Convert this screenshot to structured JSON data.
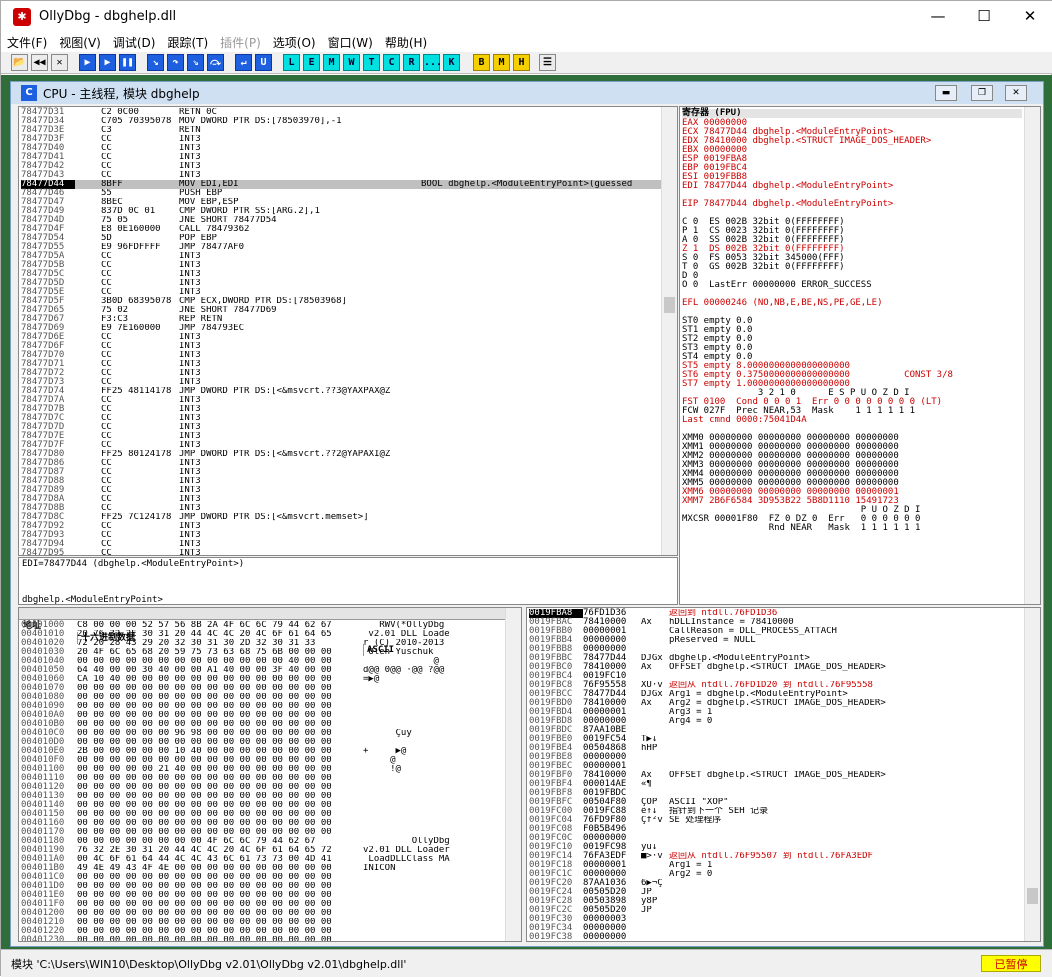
{
  "window": {
    "title": "OllyDbg - dbghelp.dll",
    "logo": "bug-icon"
  },
  "menu": [
    "文件(F)",
    "视图(V)",
    "调试(D)",
    "跟踪(T)",
    "插件(P)",
    "选项(O)",
    "窗口(W)",
    "帮助(H)"
  ],
  "toolbar_letters": [
    "L",
    "E",
    "M",
    "W",
    "T",
    "C",
    "R",
    "...",
    "K",
    "B",
    "M",
    "H"
  ],
  "cpu": {
    "title": "CPU - 主线程, 模块 dbghelp"
  },
  "disasm": [
    [
      "78477D31",
      "C2 0C00",
      "RETN 0C",
      ""
    ],
    [
      "78477D34",
      "C705 70395078",
      "MOV DWORD PTR DS:[78503970],-1",
      ""
    ],
    [
      "78477D3E",
      "C3",
      "RETN",
      ""
    ],
    [
      "78477D3F",
      "CC",
      "INT3",
      ""
    ],
    [
      "78477D40",
      "CC",
      "INT3",
      ""
    ],
    [
      "78477D41",
      "CC",
      "INT3",
      ""
    ],
    [
      "78477D42",
      "CC",
      "INT3",
      ""
    ],
    [
      "78477D43",
      "CC",
      "INT3",
      ""
    ],
    [
      "78477D44",
      "8BFF",
      "MOV EDI,EDI",
      "BOOL dbghelp.<ModuleEntryPoint>(guessed"
    ],
    [
      "78477D46",
      "55",
      "PUSH EBP",
      ""
    ],
    [
      "78477D47",
      "8BEC",
      "MOV EBP,ESP",
      ""
    ],
    [
      "78477D49",
      "837D 0C 01",
      "CMP DWORD PTR SS:[ARG.2],1",
      ""
    ],
    [
      "78477D4D",
      "75 05",
      "JNE SHORT 78477D54",
      ""
    ],
    [
      "78477D4F",
      "E8 0E160000",
      "CALL 78479362",
      ""
    ],
    [
      "78477D54",
      "5D",
      "POP EBP",
      ""
    ],
    [
      "78477D55",
      "E9 96FDFFFF",
      "JMP 78477AF0",
      ""
    ],
    [
      "78477D5A",
      "CC",
      "INT3",
      ""
    ],
    [
      "78477D5B",
      "CC",
      "INT3",
      ""
    ],
    [
      "78477D5C",
      "CC",
      "INT3",
      ""
    ],
    [
      "78477D5D",
      "CC",
      "INT3",
      ""
    ],
    [
      "78477D5E",
      "CC",
      "INT3",
      ""
    ],
    [
      "78477D5F",
      "3B0D 68395078",
      "CMP ECX,DWORD PTR DS:[78503968]",
      ""
    ],
    [
      "78477D65",
      "75 02",
      "JNE SHORT 78477D69",
      ""
    ],
    [
      "78477D67",
      "F3:C3",
      "REP RETN",
      ""
    ],
    [
      "78477D69",
      "E9 7E160000",
      "JMP 784793EC",
      ""
    ],
    [
      "78477D6E",
      "CC",
      "INT3",
      ""
    ],
    [
      "78477D6F",
      "CC",
      "INT3",
      ""
    ],
    [
      "78477D70",
      "CC",
      "INT3",
      ""
    ],
    [
      "78477D71",
      "CC",
      "INT3",
      ""
    ],
    [
      "78477D72",
      "CC",
      "INT3",
      ""
    ],
    [
      "78477D73",
      "CC",
      "INT3",
      ""
    ],
    [
      "78477D74",
      "FF25 48114178",
      "JMP DWORD PTR DS:[<&msvcrt.??3@YAXPAX@Z",
      ""
    ],
    [
      "78477D7A",
      "CC",
      "INT3",
      ""
    ],
    [
      "78477D7B",
      "CC",
      "INT3",
      ""
    ],
    [
      "78477D7C",
      "CC",
      "INT3",
      ""
    ],
    [
      "78477D7D",
      "CC",
      "INT3",
      ""
    ],
    [
      "78477D7E",
      "CC",
      "INT3",
      ""
    ],
    [
      "78477D7F",
      "CC",
      "INT3",
      ""
    ],
    [
      "78477D80",
      "FF25 80124178",
      "JMP DWORD PTR DS:[<&msvcrt.??2@YAPAXI@Z",
      ""
    ],
    [
      "78477D86",
      "CC",
      "INT3",
      ""
    ],
    [
      "78477D87",
      "CC",
      "INT3",
      ""
    ],
    [
      "78477D88",
      "CC",
      "INT3",
      ""
    ],
    [
      "78477D89",
      "CC",
      "INT3",
      ""
    ],
    [
      "78477D8A",
      "CC",
      "INT3",
      ""
    ],
    [
      "78477D8B",
      "CC",
      "INT3",
      ""
    ],
    [
      "78477D8C",
      "FF25 7C124178",
      "JMP DWORD PTR DS:[<&msvcrt.memset>]",
      ""
    ],
    [
      "78477D92",
      "CC",
      "INT3",
      ""
    ],
    [
      "78477D93",
      "CC",
      "INT3",
      ""
    ],
    [
      "78477D94",
      "CC",
      "INT3",
      ""
    ],
    [
      "78477D95",
      "CC",
      "INT3",
      ""
    ]
  ],
  "info": {
    "line1": "EDI=78477D44 (dbghelp.<ModuleEntryPoint>)",
    "line2": "dbghelp.<ModuleEntryPoint>"
  },
  "registers": {
    "header": "寄存器 (FPU)",
    "lines": [
      "EAX 00000000",
      "ECX 78477D44 dbghelp.<ModuleEntryPoint>",
      "EDX 78410000 dbghelp.<STRUCT IMAGE_DOS_HEADER>",
      "EBX 00000000",
      "ESP 0019FBA8",
      "EBP 0019FBC4",
      "ESI 0019FBB8",
      "EDI 78477D44 dbghelp.<ModuleEntryPoint>",
      "",
      "EIP 78477D44 dbghelp.<ModuleEntryPoint>",
      "",
      "C 0  ES 002B 32bit 0(FFFFFFFF)",
      "P 1  CS 0023 32bit 0(FFFFFFFF)",
      "A 0  SS 002B 32bit 0(FFFFFFFF)",
      "Z 1  DS 002B 32bit 0(FFFFFFFF)",
      "S 0  FS 0053 32bit 345000(FFF)",
      "T 0  GS 002B 32bit 0(FFFFFFFF)",
      "D 0",
      "O 0  LastErr 00000000 ERROR_SUCCESS",
      "",
      "EFL 00000246 (NO,NB,E,BE,NS,PE,GE,LE)",
      "",
      "ST0 empty 0.0",
      "ST1 empty 0.0",
      "ST2 empty 0.0",
      "ST3 empty 0.0",
      "ST4 empty 0.0",
      "ST5 empty 8.0000000000000000000",
      "ST6 empty 0.3750000000000000000          CONST 3/8",
      "ST7 empty 1.0000000000000000000",
      "              3 2 1 0      E S P U O Z D I",
      "FST 0100  Cond 0 0 0 1  Err 0 0 0 0 0 0 0 0 (LT)",
      "FCW 027F  Prec NEAR,53  Mask    1 1 1 1 1 1",
      "Last cmnd 0000:75041D4A",
      "",
      "XMM0 00000000 00000000 00000000 00000000",
      "XMM1 00000000 00000000 00000000 00000000",
      "XMM2 00000000 00000000 00000000 00000000",
      "XMM3 00000000 00000000 00000000 00000000",
      "XMM4 00000000 00000000 00000000 00000000",
      "XMM5 00000000 00000000 00000000 00000000",
      "XMM6 00000000 00000000 00000000 00000001",
      "XMM7 2B6F6584 3D953B22 5B8D1110 15491723",
      "                                 P U O Z D I",
      "MXCSR 00001F80  FZ 0 DZ 0  Err   0 0 0 0 0 0",
      "                Rnd NEAR   Mask  1 1 1 1 1 1"
    ]
  },
  "dump": {
    "headers": [
      "地址",
      "十六进制数据",
      "ASCII"
    ],
    "rows": [
      [
        "00401000",
        "C8 00 00 00 52 57 56 8B 2A 4F 6C 6C 79 44 62 67",
        "   RWV(*OllyDbg"
      ],
      [
        "00401010",
        "20 76 32 2E 30 31 20 44 4C 4C 20 4C 6F 61 64 65",
        " v2.01 DLL Loade"
      ],
      [
        "00401020",
        "72 20 28 43 29 20 32 30 31 30 2D 32 30 31 33",
        "r (C) 2010-2013"
      ],
      [
        "00401030",
        "20 4F 6C 65 68 20 59 75 73 63 68 75 6B 00 00 00",
        " Oleh Yuschuk"
      ],
      [
        "00401040",
        "00 00 00 00 00 00 00 00 00 00 00 00 00 40 00 00",
        "             @"
      ],
      [
        "00401050",
        "64 40 00 00 30 40 00 00 A1 40 00 00 3F 40 00 00",
        "d@@ 0@@ ·@@ ?@@"
      ],
      [
        "00401060",
        "CA 10 40 00 00 00 00 00 00 00 00 00 00 00 00 00",
        "=▶@"
      ],
      [
        "00401070",
        "00 00 00 00 00 00 00 00 00 00 00 00 00 00 00 00",
        ""
      ],
      [
        "00401080",
        "00 00 00 00 00 00 00 00 00 00 00 00 00 00 00 00",
        ""
      ],
      [
        "00401090",
        "00 00 00 00 00 00 00 00 00 00 00 00 00 00 00 00",
        ""
      ],
      [
        "004010A0",
        "00 00 00 00 00 00 00 00 00 00 00 00 00 00 00 00",
        ""
      ],
      [
        "004010B0",
        "00 00 00 00 00 00 00 00 00 00 00 00 00 00 00 00",
        ""
      ],
      [
        "004010C0",
        "00 00 00 00 00 00 96 98 00 00 00 00 00 00 00 00",
        "      Çüÿ"
      ],
      [
        "004010D0",
        "00 00 00 00 00 00 00 00 00 00 00 00 00 00 00 00",
        ""
      ],
      [
        "004010E0",
        "2B 00 00 00 00 00 10 40 00 00 00 00 00 00 00 00",
        "+     ▶@"
      ],
      [
        "004010F0",
        "00 00 00 00 00 00 00 00 00 00 00 00 00 00 00 00",
        "     @"
      ],
      [
        "00401100",
        "00 00 00 00 00 21 40 00 00 00 00 00 00 00 00 00",
        "     !@"
      ],
      [
        "00401110",
        "00 00 00 00 00 00 00 00 00 00 00 00 00 00 00 00",
        ""
      ],
      [
        "00401120",
        "00 00 00 00 00 00 00 00 00 00 00 00 00 00 00 00",
        ""
      ],
      [
        "00401130",
        "00 00 00 00 00 00 00 00 00 00 00 00 00 00 00 00",
        ""
      ],
      [
        "00401140",
        "00 00 00 00 00 00 00 00 00 00 00 00 00 00 00 00",
        ""
      ],
      [
        "00401150",
        "00 00 00 00 00 00 00 00 00 00 00 00 00 00 00 00",
        ""
      ],
      [
        "00401160",
        "00 00 00 00 00 00 00 00 00 00 00 00 00 00 00 00",
        ""
      ],
      [
        "00401170",
        "00 00 00 00 00 00 00 00 00 00 00 00 00 00 00 00",
        ""
      ],
      [
        "00401180",
        "00 00 00 00 00 00 00 00 4F 6C 6C 79 44 62 67",
        "         OllyDbg"
      ],
      [
        "00401190",
        "76 32 2E 30 31 20 44 4C 4C 20 4C 6F 61 64 65 72",
        "v2.01 DLL Loader"
      ],
      [
        "004011A0",
        "00 4C 6F 61 64 44 4C 4C 43 6C 61 73 73 00 4D 41",
        " LoadDLLClass MA"
      ],
      [
        "004011B0",
        "49 4E 49 43 4F 4E 00 00 00 00 00 00 00 00 00 00",
        "INICON        "
      ],
      [
        "004011C0",
        "00 00 00 00 00 00 00 00 00 00 00 00 00 00 00 00",
        ""
      ],
      [
        "004011D0",
        "00 00 00 00 00 00 00 00 00 00 00 00 00 00 00 00",
        ""
      ],
      [
        "004011E0",
        "00 00 00 00 00 00 00 00 00 00 00 00 00 00 00 00",
        ""
      ],
      [
        "004011F0",
        "00 00 00 00 00 00 00 00 00 00 00 00 00 00 00 00",
        ""
      ],
      [
        "00401200",
        "00 00 00 00 00 00 00 00 00 00 00 00 00 00 00 00",
        ""
      ],
      [
        "00401210",
        "00 00 00 00 00 00 00 00 00 00 00 00 00 00 00 00",
        ""
      ],
      [
        "00401220",
        "00 00 00 00 00 00 00 00 00 00 00 00 00 00 00 00",
        ""
      ],
      [
        "00401230",
        "00 00 00 00 00 00 00 00 00 00 00 00 00 00 00 00",
        ""
      ]
    ]
  },
  "stack": [
    [
      "0019FBA8",
      "76FD1D36",
      "",
      "返回到 ntdll.76FD1D36"
    ],
    [
      "0019FBAC",
      "78410000",
      "Ax",
      "hDLLInstance = 78410000"
    ],
    [
      "0019FBB0",
      "00000001",
      "",
      "CallReason = DLL_PROCESS_ATTACH"
    ],
    [
      "0019FBB4",
      "00000000",
      "",
      "pReserved = NULL"
    ],
    [
      "0019FBB8",
      "00000000",
      "",
      ""
    ],
    [
      "0019FBBC",
      "78477D44",
      "DJGx",
      "dbghelp.<ModuleEntryPoint>"
    ],
    [
      "0019FBC0",
      "78410000",
      "Ax",
      "OFFSET dbghelp.<STRUCT IMAGE_DOS_HEADER>"
    ],
    [
      "0019FBC4",
      "0019FC10",
      "",
      ""
    ],
    [
      "0019FBC8",
      "76F95558",
      "XU·v",
      "返回从 ntdll.76FD1D20 到 ntdll.76F95558"
    ],
    [
      "0019FBCC",
      "78477D44",
      "DJGx",
      "Arg1 = dbghelp.<ModuleEntryPoint>"
    ],
    [
      "0019FBD0",
      "78410000",
      "Ax",
      "Arg2 = dbghelp.<STRUCT IMAGE_DOS_HEADER>"
    ],
    [
      "0019FBD4",
      "00000001",
      "",
      "Arg3 = 1"
    ],
    [
      "0019FBD8",
      "00000000",
      "",
      "Arg4 = 0"
    ],
    [
      "0019FBDC",
      "87AA10BE",
      "",
      ""
    ],
    [
      "0019FBE0",
      "0019FC54",
      "T▶↓",
      ""
    ],
    [
      "0019FBE4",
      "00504868",
      "hHP",
      ""
    ],
    [
      "0019FBE8",
      "00000000",
      "",
      ""
    ],
    [
      "0019FBEC",
      "00000001",
      "",
      ""
    ],
    [
      "0019FBF0",
      "78410000",
      "Ax",
      "OFFSET dbghelp.<STRUCT IMAGE_DOS_HEADER>"
    ],
    [
      "0019FBF4",
      "000014AE",
      "«¶",
      ""
    ],
    [
      "0019FBF8",
      "0019FBDC",
      "",
      ""
    ],
    [
      "0019FBFC",
      "00504F80",
      "ÇOP",
      "ASCII \"XOP\""
    ],
    [
      "0019FC00",
      "0019FC88",
      "ê↑↓",
      "指针到下一个 SEH 记录"
    ],
    [
      "0019FC04",
      "76FD9F80",
      "Çf²v",
      "SE 处理程序"
    ],
    [
      "0019FC08",
      "F0B5B496",
      "",
      ""
    ],
    [
      "0019FC0C",
      "00000000",
      "",
      ""
    ],
    [
      "0019FC10",
      "0019FC98",
      "ÿü↓",
      ""
    ],
    [
      "0019FC14",
      "76FA3EDF",
      "■>·v",
      "返回从 ntdll.76F95507 到 ntdll.76FA3EDF"
    ],
    [
      "0019FC18",
      "00000001",
      "",
      "Arg1 = 1"
    ],
    [
      "0019FC1C",
      "00000000",
      "",
      "Arg2 = 0"
    ],
    [
      "0019FC20",
      "87AA1036",
      "6▶¬Ç",
      ""
    ],
    [
      "0019FC24",
      "00505D20",
      "JP",
      ""
    ],
    [
      "0019FC28",
      "00503898",
      "ÿ8P",
      ""
    ],
    [
      "0019FC2C",
      "00505D20",
      "JP",
      ""
    ],
    [
      "0019FC30",
      "00000003",
      "",
      ""
    ],
    [
      "0019FC34",
      "00000000",
      "",
      ""
    ],
    [
      "0019FC38",
      "00000000",
      "",
      ""
    ]
  ],
  "status": {
    "message": "模块 'C:\\Users\\WIN10\\Desktop\\OllyDbg v2.01\\OllyDbg v2.01\\dbghelp.dll'",
    "state": "已暂停"
  },
  "colors": {
    "accent": "#1e5fe0",
    "highlight": "#c0c0c0",
    "red": "#cc0000",
    "paused_bg": "#ffff00"
  }
}
